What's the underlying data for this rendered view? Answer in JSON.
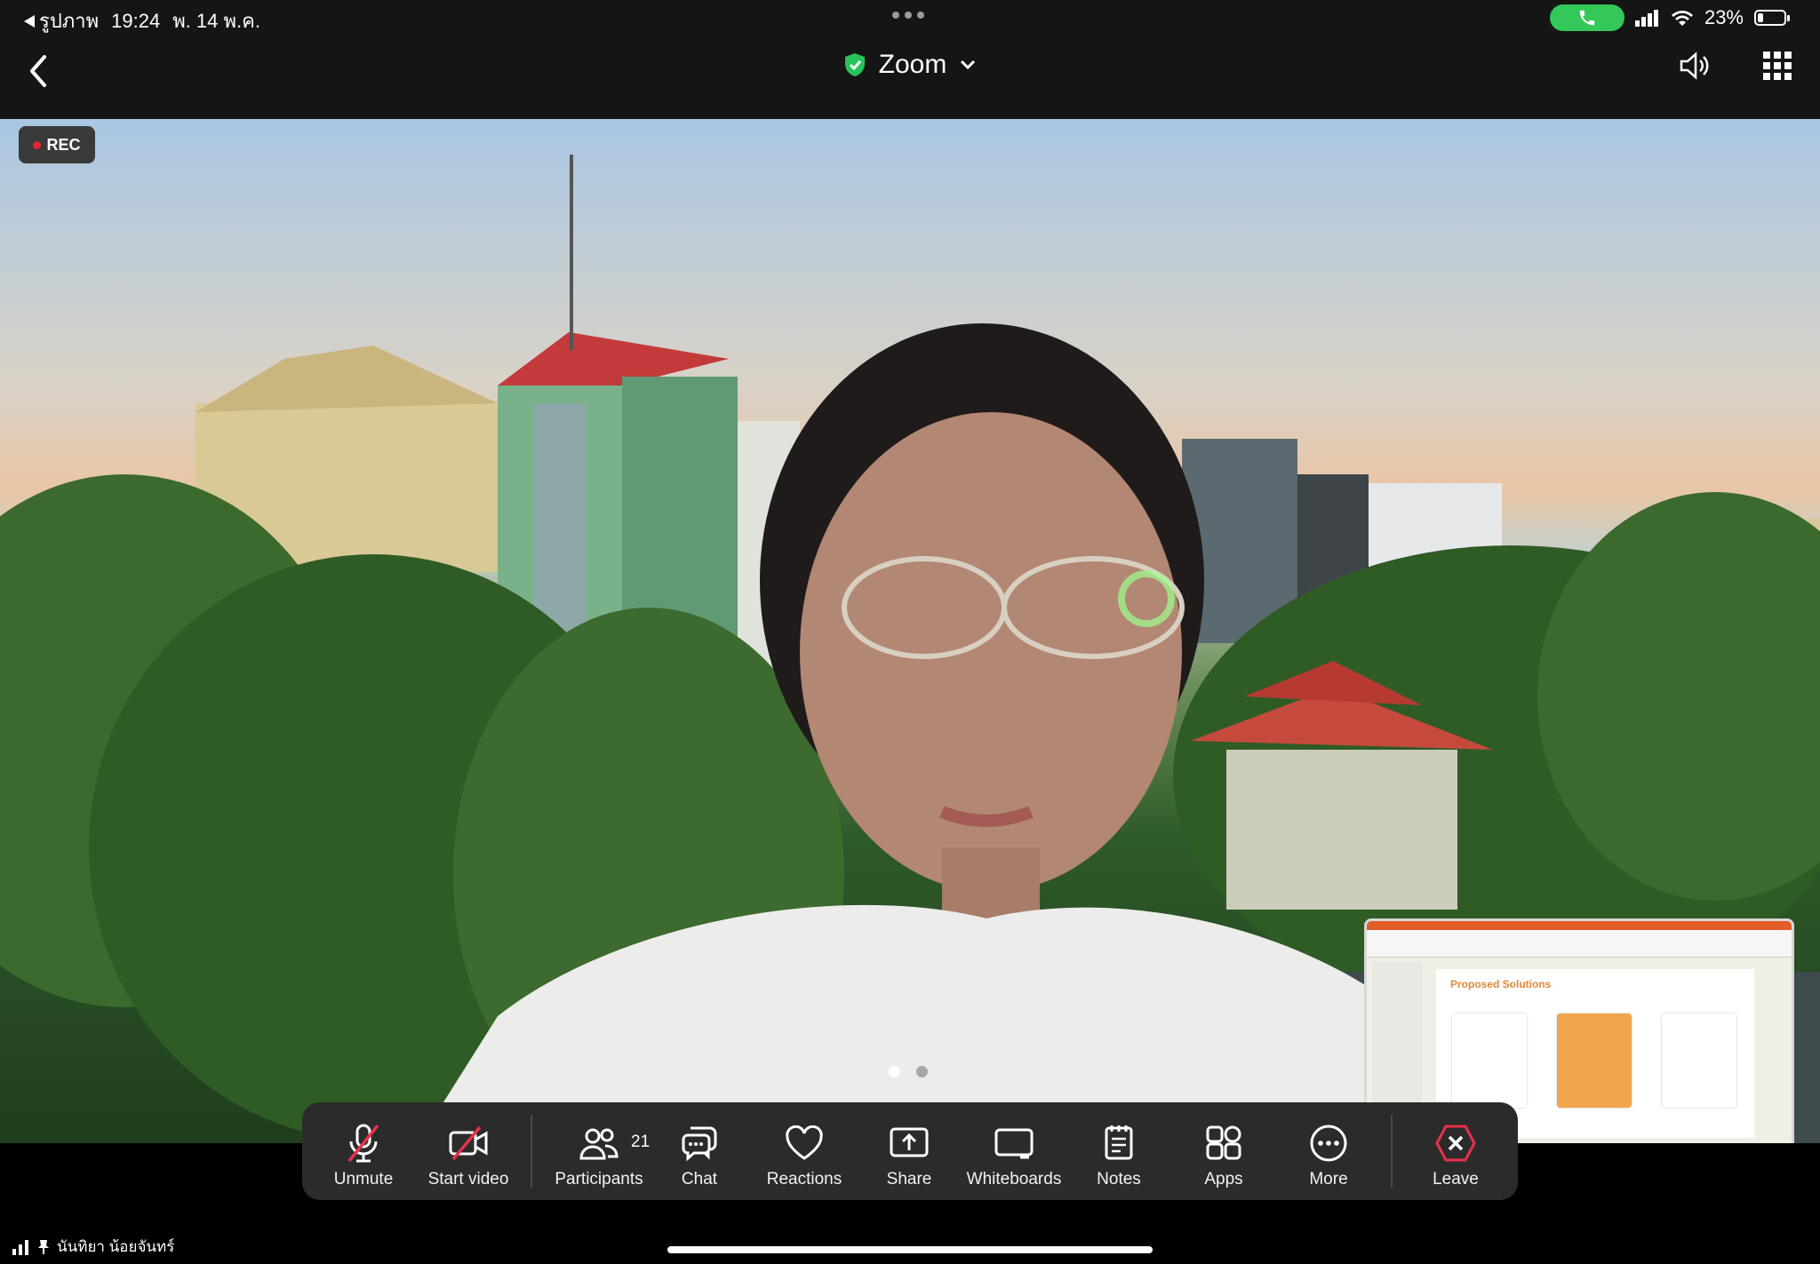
{
  "status_bar": {
    "back_app": "รูปภาพ",
    "time": "19:24",
    "date": "พ. 14 พ.ค.",
    "battery": "23%",
    "battery_level": 0.23,
    "call_color": "#34c759"
  },
  "nav": {
    "title": "Zoom",
    "icons": [
      "chevron-left-icon",
      "shield-check-icon",
      "chevron-down-icon",
      "speaker-icon",
      "grid-icon"
    ],
    "shield_color": "#27c35a"
  },
  "video": {
    "rec_label": "REC",
    "rec_color": "#e0262f",
    "pages": 2,
    "active_page": 1
  },
  "shared_screen": {
    "slide_title": "Proposed Solutions",
    "accent": "#e3883b"
  },
  "toolbar": {
    "items": [
      {
        "label": "Unmute",
        "icon": "mic-off-icon"
      },
      {
        "label": "Start video",
        "icon": "video-off-icon"
      },
      {
        "label": "Participants",
        "icon": "participants-icon",
        "count": "21"
      },
      {
        "label": "Chat",
        "icon": "chat-icon"
      },
      {
        "label": "Reactions",
        "icon": "heart-icon"
      },
      {
        "label": "Share",
        "icon": "share-icon"
      },
      {
        "label": "Whiteboards",
        "icon": "whiteboard-icon"
      },
      {
        "label": "Notes",
        "icon": "notes-icon"
      },
      {
        "label": "Apps",
        "icon": "apps-icon"
      },
      {
        "label": "More",
        "icon": "more-icon"
      },
      {
        "label": "Leave",
        "icon": "leave-icon"
      }
    ],
    "leave_color": "#e9304a"
  },
  "bottom": {
    "pinned_name": "นันทิยา น้อยจันทร์"
  }
}
